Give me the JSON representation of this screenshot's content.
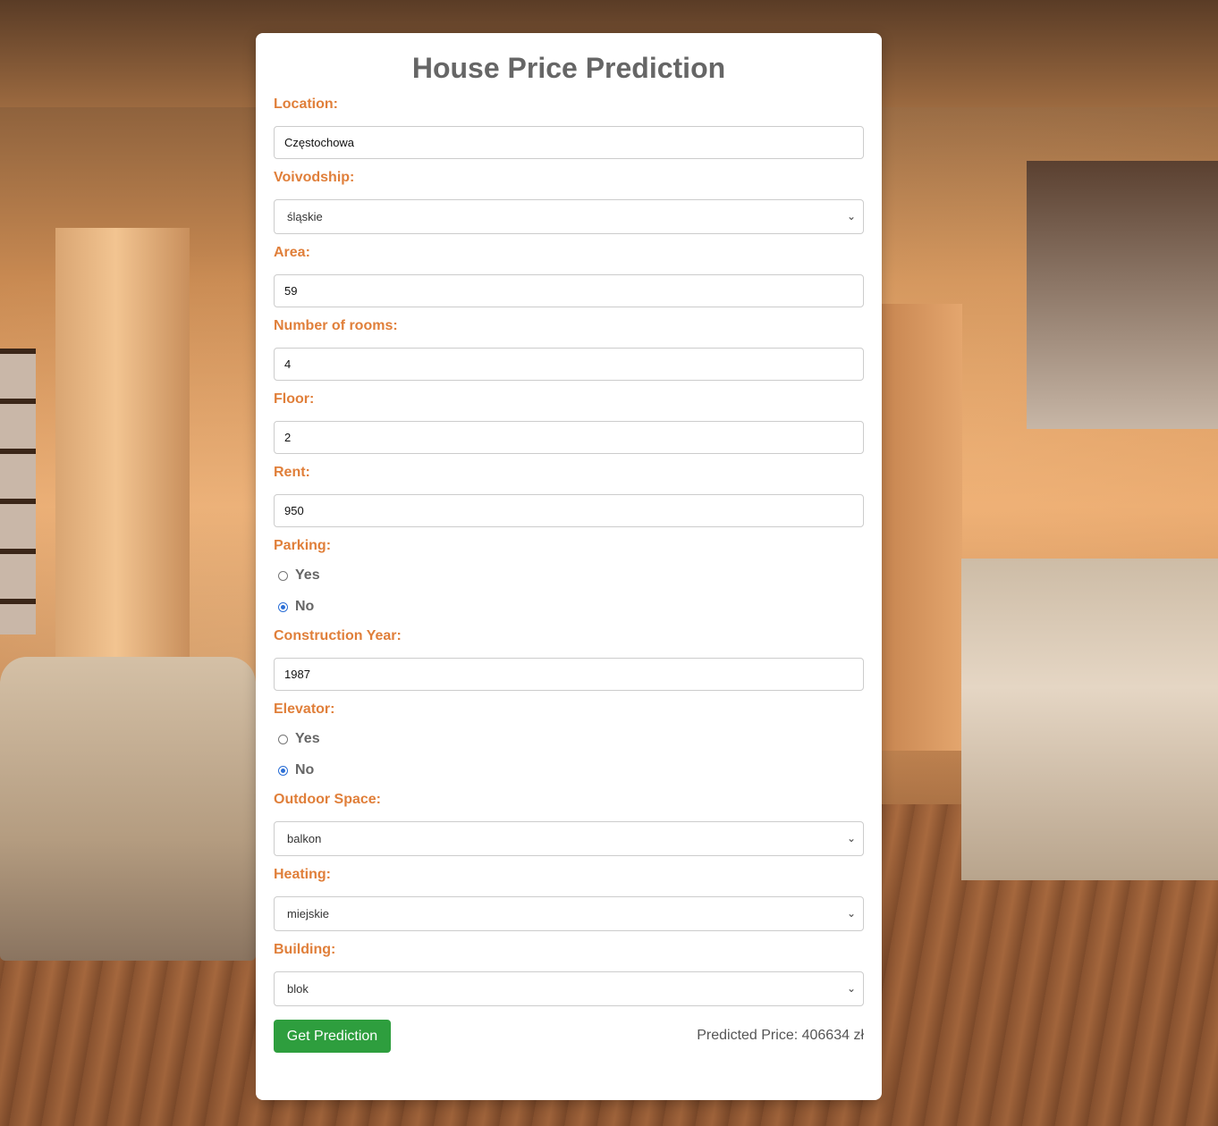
{
  "form": {
    "title": "House Price Prediction",
    "location": {
      "label": "Location:",
      "value": "Częstochowa"
    },
    "voivodship": {
      "label": "Voivodship:",
      "value": "śląskie"
    },
    "area": {
      "label": "Area:",
      "value": "59"
    },
    "rooms": {
      "label": "Number of rooms:",
      "value": "4"
    },
    "floor": {
      "label": "Floor:",
      "value": "2"
    },
    "rent": {
      "label": "Rent:",
      "value": "950"
    },
    "parking": {
      "label": "Parking:",
      "yes": "Yes",
      "no": "No",
      "selected": "No"
    },
    "construction_year": {
      "label": "Construction Year:",
      "value": "1987"
    },
    "elevator": {
      "label": "Elevator:",
      "yes": "Yes",
      "no": "No",
      "selected": "No"
    },
    "outdoor_space": {
      "label": "Outdoor Space:",
      "value": "balkon"
    },
    "heating": {
      "label": "Heating:",
      "value": "miejskie"
    },
    "building": {
      "label": "Building:",
      "value": "blok"
    },
    "submit_label": "Get Prediction",
    "result": "Predicted Price: 406634 zł"
  },
  "icons": {
    "dropdown": "chevron-down-icon"
  },
  "colors": {
    "label": "#e07f3a",
    "title": "#666666",
    "button": "#2e9e3e",
    "radio_checked": "#2b6fd6"
  }
}
